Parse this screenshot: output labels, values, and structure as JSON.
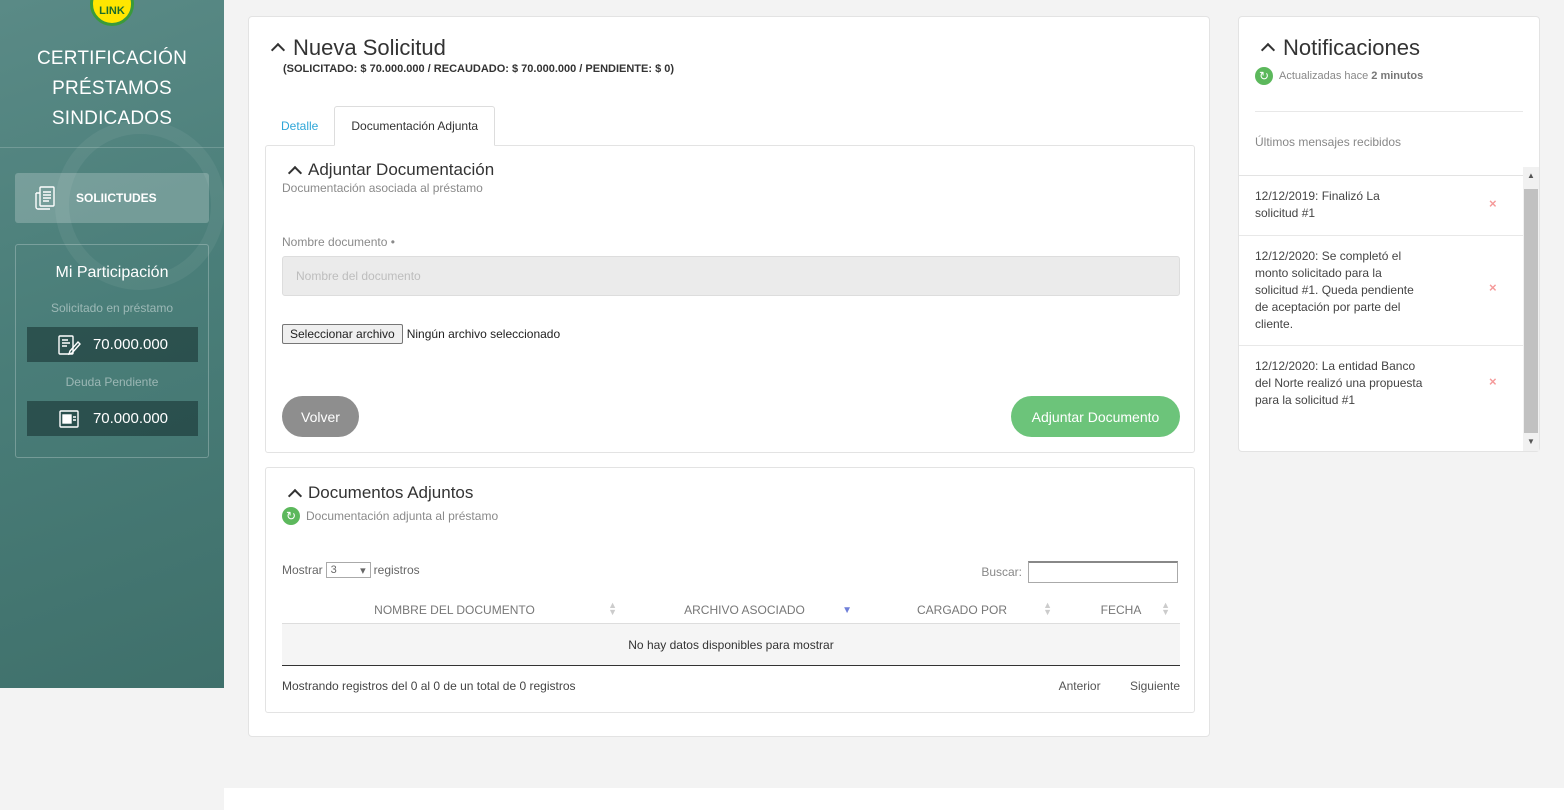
{
  "sidebar": {
    "logo_text": "LINK",
    "brand_lines": [
      "CERTIFICACIÓN",
      "PRÉSTAMOS",
      "SINDICADOS"
    ],
    "nav_button": "SOLIICTUDES",
    "participation": {
      "title": "Mi Participación",
      "requested_label": "Solicitado en préstamo",
      "requested_value": "70.000.000",
      "pending_label": "Deuda Pendiente",
      "pending_value": "70.000.000"
    }
  },
  "main": {
    "title": "Nueva Solicitud",
    "summary": "(SOLICITADO: $ 70.000.000 / RECAUDADO: $ 70.000.000 / PENDIENTE: $ 0)",
    "tabs": [
      {
        "label": "Detalle",
        "active": false
      },
      {
        "label": "Documentación Adjunta",
        "active": true
      }
    ],
    "attach": {
      "title": "Adjuntar Documentación",
      "subtitle": "Documentación asociada al préstamo",
      "field_label": "Nombre documento •",
      "field_placeholder": "Nombre del documento",
      "file_button": "Seleccionar archivo",
      "file_status": "Ningún archivo seleccionado",
      "back_button": "Volver",
      "attach_button": "Adjuntar Documento"
    },
    "docs": {
      "title": "Documentos Adjuntos",
      "subtitle": "Documentación adjunta al préstamo",
      "show_label": "Mostrar",
      "show_value": "3",
      "records_label": "registros",
      "search_label": "Buscar:",
      "columns": [
        "NOMBRE DEL DOCUMENTO",
        "ARCHIVO ASOCIADO",
        "CARGADO POR",
        "FECHA"
      ],
      "empty": "No hay datos disponibles para mostrar",
      "footer_info": "Mostrando registros del 0 al 0 de un total de 0 registros",
      "prev": "Anterior",
      "next": "Siguiente"
    }
  },
  "notifications": {
    "title": "Notificaciones",
    "updated_prefix": "Actualizadas hace",
    "updated_value": "2 minutos",
    "last_label": "Últimos mensajes recibidos",
    "messages": [
      {
        "text": "12/12/2019: Finalizó La solicitud #1"
      },
      {
        "text": "12/12/2020: Se completó el monto solicitado para la solicitud #1. Queda pendiente de aceptación por parte del cliente."
      },
      {
        "text": "12/12/2020: La entidad Banco del Norte realizó una propuesta para la solicitud #1"
      }
    ],
    "dismiss_glyph": "×"
  },
  "colors": {
    "sidebar": "#4a7e79",
    "accent_green": "#6cc47a",
    "link_blue": "#2fa6d8",
    "back_gray": "#8e8e8e",
    "dismiss_red": "#f59a9a"
  }
}
